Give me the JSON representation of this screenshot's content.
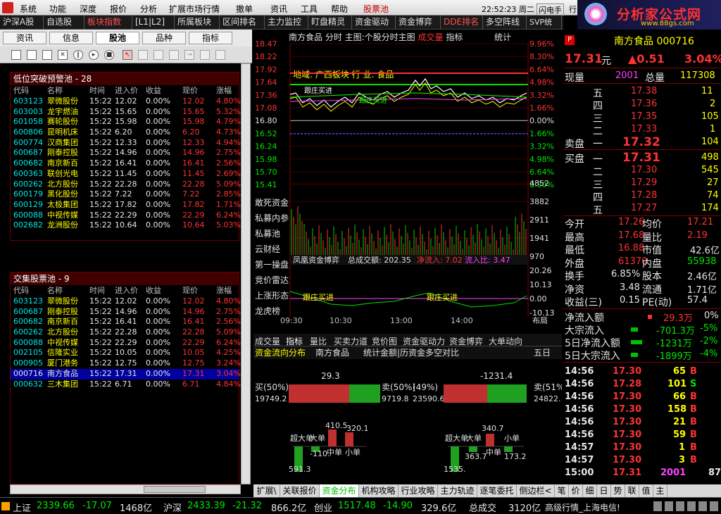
{
  "menu": {
    "items": [
      "系统",
      "功能",
      "深度",
      "报价",
      "分析",
      "扩展市场行情",
      "撤单",
      "资讯",
      "工具",
      "帮助",
      "股票池"
    ],
    "time": "22:52:23 周二",
    "flash": "闪电手",
    "trade": "行"
  },
  "logo": {
    "text": "分析家公式网",
    "url": "www.88gs.com"
  },
  "tabs": [
    "沪深A股",
    "自选股",
    "板块指数",
    "[L1|L2]",
    "所属板块",
    "区间排名",
    "主力监控",
    "盯盘精灵",
    "资金驱动",
    "资金博弈",
    "DDE排名",
    "多空阵线",
    "SVP统计",
    "强"
  ],
  "left_tabs": [
    "资讯",
    "信息",
    "股池",
    "品种",
    "指标"
  ],
  "pool1": {
    "title": "低位突破预警池 - 28",
    "cols": [
      "代码",
      "名称",
      "时间",
      "进入价",
      "收益",
      "现价",
      "涨幅"
    ],
    "rows": [
      [
        "603123",
        "翠微股份",
        "15:22",
        "12.02",
        "0.00%",
        "12.02",
        "4.80%"
      ],
      [
        "603003",
        "龙宇燃油",
        "15:22",
        "15.65",
        "0.00%",
        "15.65",
        "5.32%"
      ],
      [
        "601058",
        "赛轮股份",
        "15:22",
        "15.98",
        "0.00%",
        "15.98",
        "4.79%"
      ],
      [
        "600806",
        "昆明机床",
        "15:22",
        "6.20",
        "0.00%",
        "6.20",
        "4.73%"
      ],
      [
        "600774",
        "汉商集团",
        "15:22",
        "12.33",
        "0.00%",
        "12.33",
        "4.94%"
      ],
      [
        "600687",
        "刚泰控股",
        "15:22",
        "14.96",
        "0.00%",
        "14.96",
        "2.75%"
      ],
      [
        "600682",
        "南京新百",
        "15:22",
        "16.41",
        "0.00%",
        "16.41",
        "2.56%"
      ],
      [
        "600363",
        "联创光电",
        "15:22",
        "11.45",
        "0.00%",
        "11.45",
        "2.69%"
      ],
      [
        "600262",
        "北方股份",
        "15:22",
        "22.28",
        "0.00%",
        "22.28",
        "5.09%"
      ],
      [
        "600179",
        "黑化股份",
        "15:22",
        "7.22",
        "0.00%",
        "7.22",
        "2.85%"
      ],
      [
        "600129",
        "太极集团",
        "15:22",
        "17.82",
        "0.00%",
        "17.82",
        "1.71%"
      ],
      [
        "600088",
        "中视传媒",
        "15:22",
        "22.29",
        "0.00%",
        "22.29",
        "6.24%"
      ],
      [
        "002682",
        "龙洲股份",
        "15:22",
        "10.64",
        "0.00%",
        "10.64",
        "5.03%"
      ]
    ]
  },
  "pool2": {
    "title": "交集股票池 - 9",
    "cols": [
      "代码",
      "名称",
      "时间",
      "进入价",
      "收益",
      "现价",
      "涨幅"
    ],
    "rows": [
      [
        "603123",
        "翠微股份",
        "15:22",
        "12.02",
        "0.00%",
        "12.02",
        "4.80%"
      ],
      [
        "600687",
        "刚泰控股",
        "15:22",
        "14.96",
        "0.00%",
        "14.96",
        "2.75%"
      ],
      [
        "600682",
        "南京新百",
        "15:22",
        "16.41",
        "0.00%",
        "16.41",
        "2.56%"
      ],
      [
        "600262",
        "北方股份",
        "15:22",
        "22.28",
        "0.00%",
        "22.28",
        "5.09%"
      ],
      [
        "600088",
        "中视传媒",
        "15:22",
        "22.29",
        "0.00%",
        "22.29",
        "6.24%"
      ],
      [
        "002105",
        "信隆实业",
        "15:22",
        "10.05",
        "0.00%",
        "10.05",
        "4.25%"
      ],
      [
        "000905",
        "厦门港务",
        "15:22",
        "12.75",
        "0.00%",
        "12.75",
        "3.24%"
      ],
      [
        "000716",
        "南方食品",
        "15:22",
        "17.31",
        "0.00%",
        "17.31",
        "3.04%"
      ],
      [
        "000632",
        "三木集团",
        "15:22",
        "6.71",
        "0.00%",
        "6.71",
        "4.84%"
      ]
    ]
  },
  "chart": {
    "header": "南方食品  分时 主图:个股分时主图",
    "hdr_red": "成交量",
    "hdr_tail": "指标",
    "stat": "统计",
    "left_axis": [
      "18.47",
      "18.22",
      "17.92",
      "17.64",
      "17.36",
      "17.08",
      "16.80",
      "16.52",
      "16.24",
      "15.98",
      "15.70",
      "15.41"
    ],
    "right_axis": [
      "9.96%",
      "8.30%",
      "6.64%",
      "4.98%",
      "3.32%",
      "1.66%",
      "0.00%",
      "1.66%",
      "3.32%",
      "4.98%",
      "6.64%",
      "8.30%"
    ],
    "vol_axis": [
      "4852",
      "3882",
      "2911",
      "1941",
      "970"
    ],
    "side_labels": [
      "敢死资金",
      "私募内参",
      "私募池",
      "云财经",
      "第一操盘",
      "竞价雷达",
      "上涨形态",
      "龙虎榜"
    ],
    "region": "地域:  广西板块   行  业:  食品",
    "annot": [
      "跟庄买进",
      "跟庄买进"
    ],
    "fund_bar": {
      "a": "凤凰资金博弈",
      "b": "总成交额: 202.35",
      "c": "净流入: 7.02",
      "d": "流入比: 3.47"
    },
    "ind_axis": [
      "20.26",
      "10.13",
      "0.00",
      "-10.13"
    ],
    "ind_labels": [
      "跟庄买进",
      "跟庄买进"
    ],
    "times": [
      "09:30",
      "10:30",
      "13:00",
      "14:00"
    ],
    "layout": "布局"
  },
  "sub_tabs": [
    "成交量",
    "指标",
    "量比",
    "买卖力道",
    "竞价图",
    "资金驱动力",
    "资金博弈",
    "大单动向"
  ],
  "fund": {
    "tabs": [
      "资金流向分布",
      "南方食品",
      "统计金额|历资金多空对比"
    ],
    "period": "五日",
    "l_top": "29.3",
    "l_left": "买(50%)",
    "l_left_v": "19749.2",
    "l_right": "卖(50%)",
    "l_right_v": "9719.8",
    "r_top": "-1231.4",
    "r_left": "(49%)",
    "r_left_v": "23590.6",
    "r_right": "卖(51%)",
    "r_right_v": "24822.",
    "l_bars": [
      "超大单",
      "大单",
      "中单",
      "小单"
    ],
    "l_vals": [
      "591.3",
      "-110.",
      "410.5",
      "320.1"
    ],
    "r_bars": [
      "超大单",
      "大单",
      "中单",
      "小单"
    ],
    "r_vals": [
      "1535.",
      "363.7",
      "340.7",
      "173.2"
    ]
  },
  "bottom_tabs": [
    "扩展\\",
    "关联报价",
    "资金分布",
    "机构攻略",
    "行业攻略",
    "主力轨迹",
    "逐笔委托",
    "侧边栏<",
    "笔",
    "价",
    "细",
    "日",
    "势",
    "联",
    "值",
    "主"
  ],
  "quote": {
    "name": "南方食品 000716",
    "price": "17.31",
    "unit": "元",
    "chg": "▲0.51",
    "pct": "3.04%",
    "now_vol_lbl": "现量",
    "now_vol": "2001",
    "tot_lbl": "总量",
    "tot": "117308",
    "asks": [
      [
        "五",
        "17.38",
        "11"
      ],
      [
        "四",
        "17.36",
        "2"
      ],
      [
        "三",
        "17.35",
        "105"
      ],
      [
        "二",
        "17.33",
        "1"
      ],
      [
        "一",
        "17.32",
        "104"
      ]
    ],
    "bids": [
      [
        "一",
        "17.31",
        "498"
      ],
      [
        "二",
        "17.30",
        "545"
      ],
      [
        "三",
        "17.29",
        "27"
      ],
      [
        "四",
        "17.28",
        "74"
      ],
      [
        "五",
        "17.27",
        "174"
      ]
    ],
    "sell_lbl": "卖盘",
    "buy_lbl": "买盘",
    "stats": [
      [
        "今开",
        "17.26",
        "均价",
        "17.21"
      ],
      [
        "最高",
        "17.68",
        "量比",
        "2.19"
      ],
      [
        "最低",
        "16.88",
        "市值",
        "42.6亿"
      ],
      [
        "外盘",
        "61370",
        "内盘",
        "55938"
      ],
      [
        "换手",
        "6.85%",
        "股本",
        "2.46亿"
      ],
      [
        "净资",
        "3.48",
        "流通",
        "1.71亿"
      ],
      [
        "收益(三)",
        "0.15",
        "PE(动)",
        "57.4"
      ]
    ],
    "flows": [
      [
        "净流入额",
        "29.3万",
        "0%"
      ],
      [
        "大宗流入",
        "-701.3万",
        "-5%"
      ],
      [
        "5日净流入额",
        "-1231万",
        "-2%"
      ],
      [
        "5日大宗流入",
        "-1899万",
        "-4%"
      ]
    ],
    "ticks": [
      [
        "14:56",
        "17.30",
        "65",
        "B"
      ],
      [
        "14:56",
        "17.28",
        "101",
        "S"
      ],
      [
        "14:56",
        "17.30",
        "66",
        "B"
      ],
      [
        "14:56",
        "17.30",
        "158",
        "B"
      ],
      [
        "14:56",
        "17.30",
        "21",
        "B"
      ],
      [
        "14:56",
        "17.30",
        "59",
        "B"
      ],
      [
        "14:57",
        "17.30",
        "1",
        "B"
      ],
      [
        "14:57",
        "17.30",
        "3",
        "B"
      ],
      [
        "15:00",
        "17.31",
        "2001",
        "87"
      ]
    ]
  },
  "status": {
    "sh": "上证",
    "sh_v": "2339.66",
    "sh_c": "-17.07",
    "sh_a": "1468亿",
    "hs": "沪深",
    "hs_v": "2433.39",
    "hs_c": "-21.32",
    "hs_a": "866.2亿",
    "cy": "创业",
    "cy_v": "1517.48",
    "cy_c": "-14.90",
    "cy_a": "329.6亿",
    "tot": "总成交",
    "tot_v": "3120亿",
    "info": "高级行情_上海电信!"
  }
}
